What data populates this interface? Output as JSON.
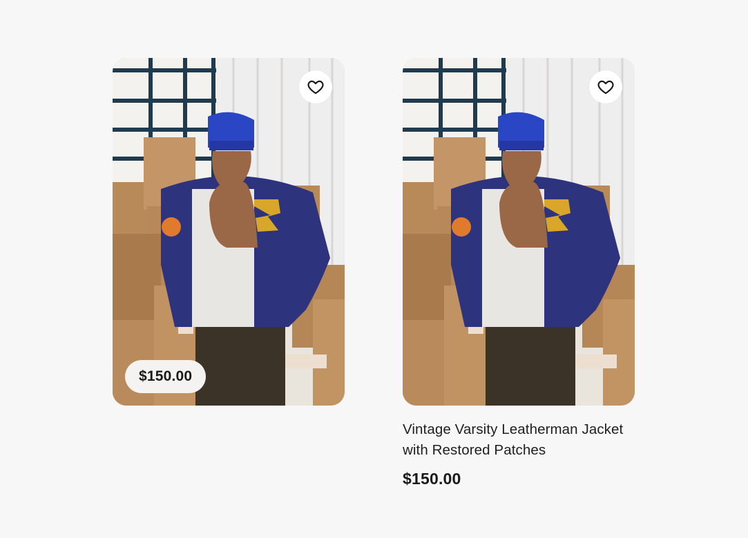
{
  "cards": [
    {
      "price_badge": "$150.00",
      "image_icon": "product-photo",
      "favorite_icon": "heart-outline-icon"
    },
    {
      "title": "Vintage Varsity Leatherman Jacket with Restored Patches",
      "price": "$150.00",
      "image_icon": "product-photo",
      "favorite_icon": "heart-outline-icon"
    }
  ],
  "colors": {
    "page_background": "#f7f7f7",
    "favorite_button": "#ffffff",
    "price_pill": "#f4f3f1",
    "text": "#1a1a1a"
  }
}
